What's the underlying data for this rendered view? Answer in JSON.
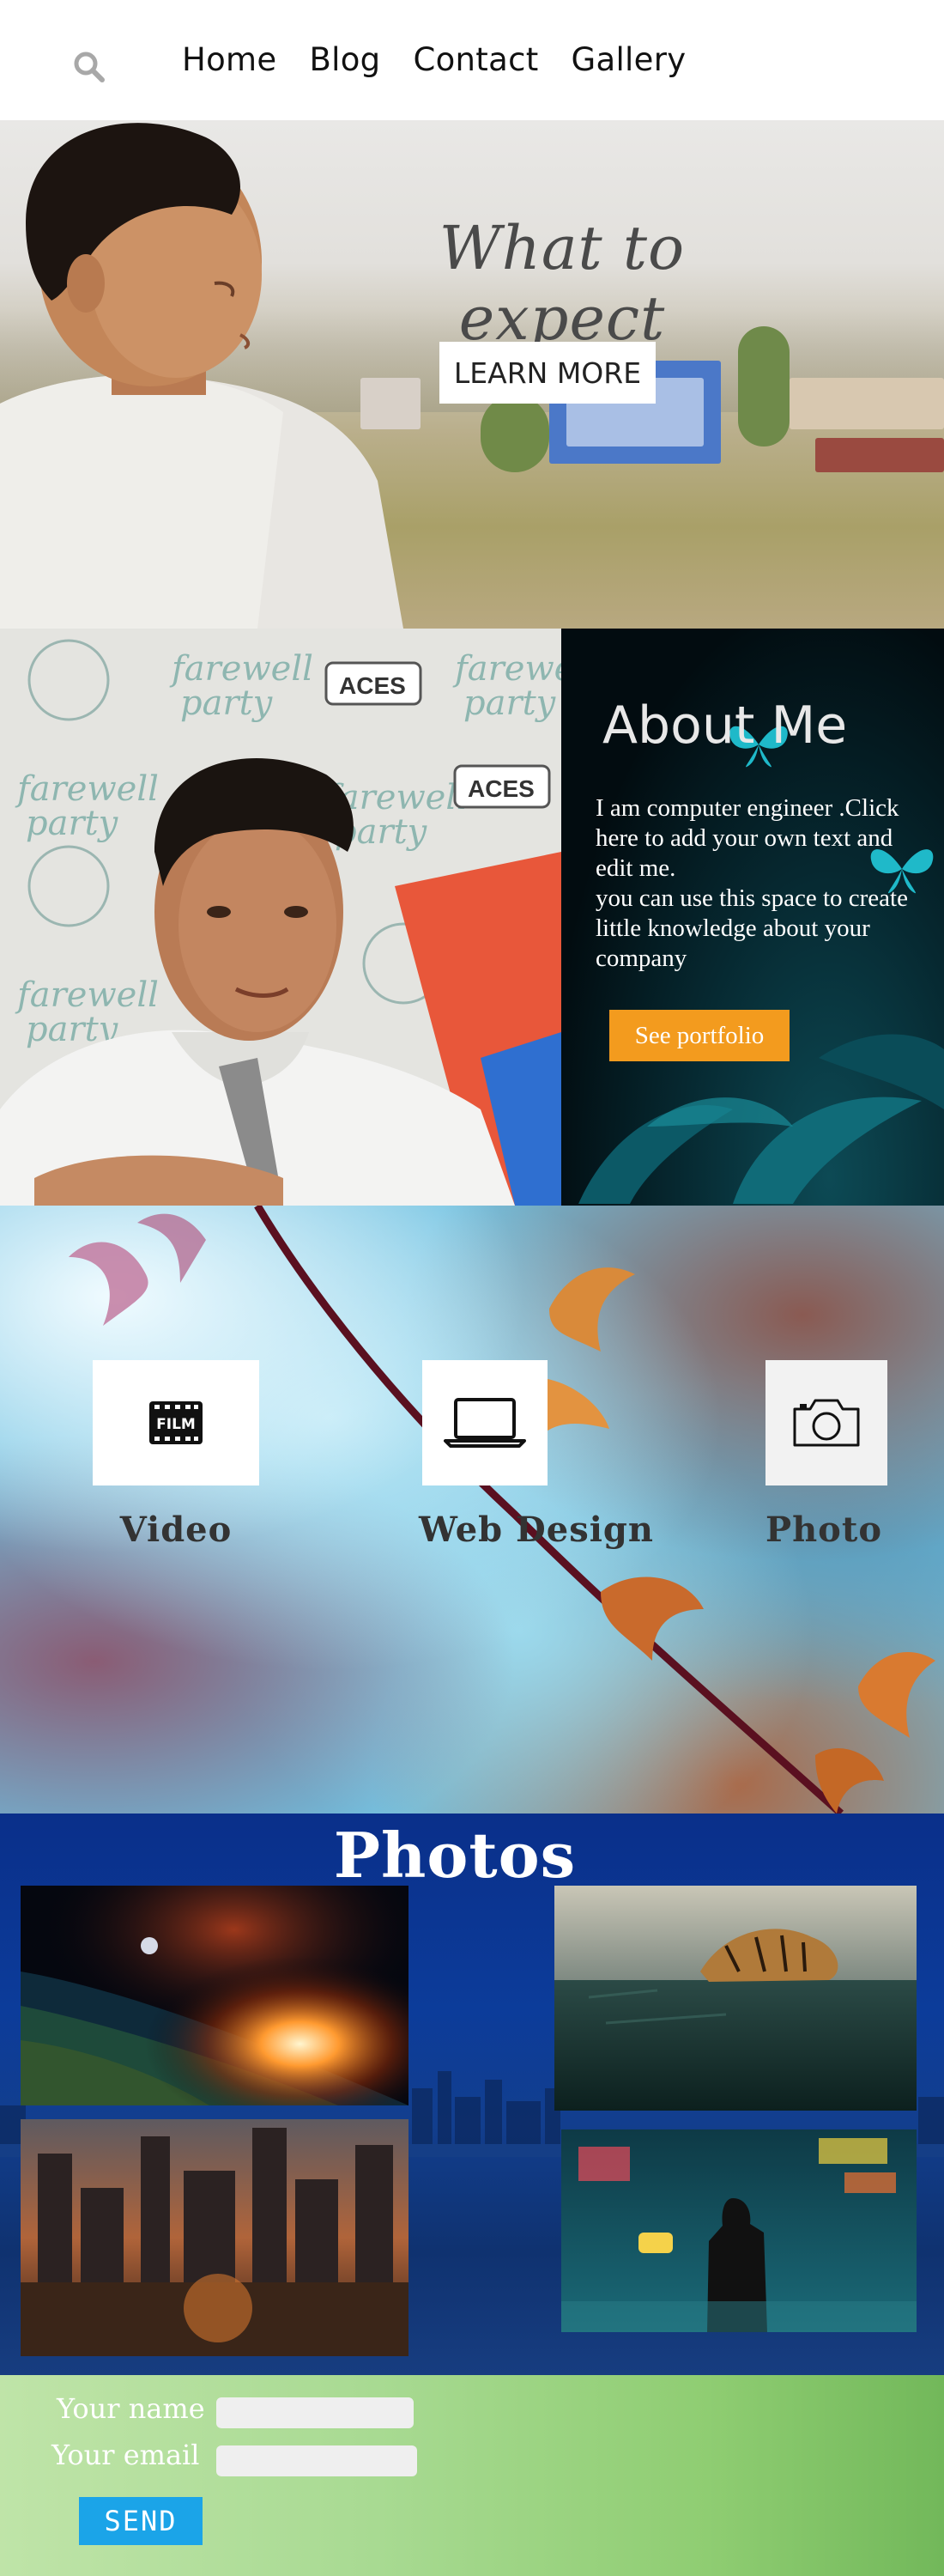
{
  "nav": {
    "search_icon": "search-icon",
    "links": [
      "Home",
      "Blog",
      "Contact",
      "Gallery"
    ]
  },
  "hero": {
    "title": "What to expect",
    "button": "LEARN MORE"
  },
  "about": {
    "title": "About Me",
    "text_lines": [
      "I am computer engineer .Click",
      "here to add your own text and",
      "edit me.",
      "you can use this space to create",
      "little knowledge about your",
      "company"
    ],
    "button": "See portfolio",
    "accent": "#f39b1e"
  },
  "services": {
    "items": [
      {
        "label": "Video",
        "icon": "film-icon",
        "icon_text": "FILM"
      },
      {
        "label": "Web Design",
        "icon": "laptop-icon"
      },
      {
        "label": "Photo",
        "icon": "camera-icon"
      }
    ]
  },
  "photos": {
    "title": "Photos",
    "items": [
      "planet-sunrise-photo",
      "tiger-sea-photo",
      "ruined-city-photo",
      "rainy-street-photo"
    ]
  },
  "contact": {
    "name_label": "Your name",
    "email_label": "Your email",
    "name_value": "",
    "email_value": "",
    "send": "SEND",
    "send_color": "#1ba4e8"
  }
}
